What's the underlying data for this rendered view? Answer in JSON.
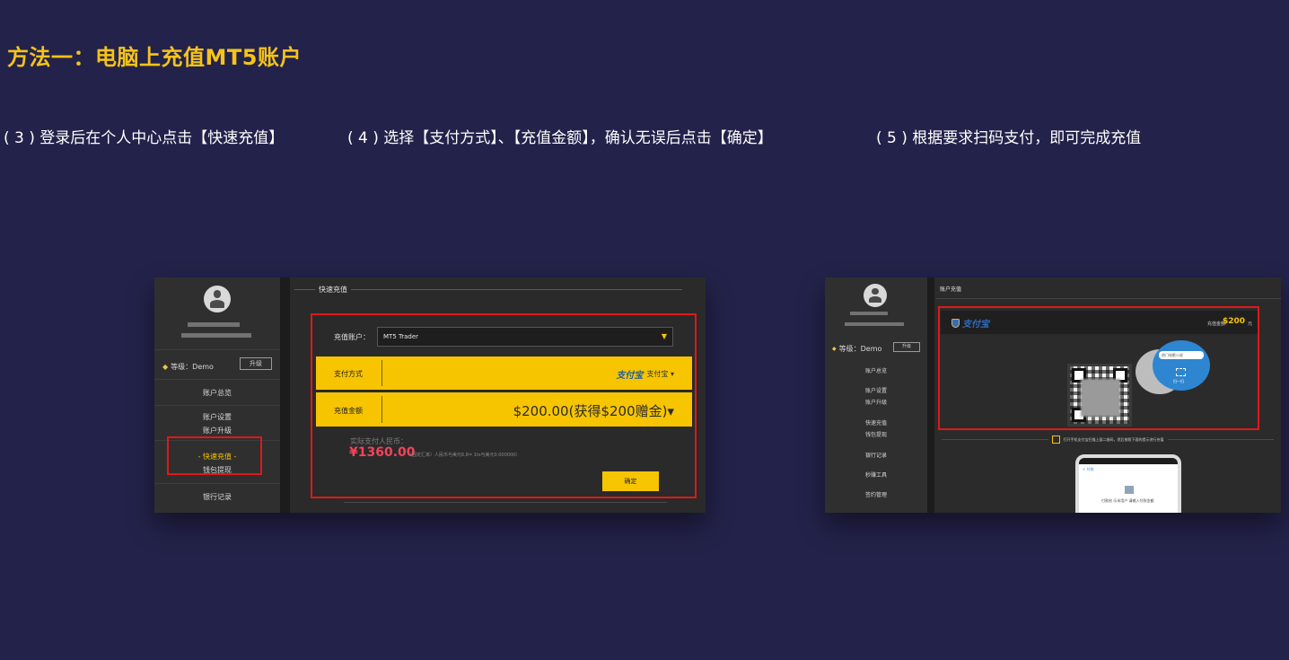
{
  "page": {
    "title": "方法一：电脑上充值MT5账户",
    "steps": [
      "( 3 ) 登录后在个人中心点击【快速充值】",
      "( 4 ) 选择【支付方式】、【充值金额】，确认无误后点击【确定】",
      "( 5 ) 根据要求扫码支付，即可完成充值"
    ]
  },
  "left_screen": {
    "level_label": "等级：Demo",
    "upgrade_button": "升级",
    "menu": [
      "账户总览",
      "账户设置",
      "账户升级",
      "- 快速充值 -",
      "钱包提现",
      "银行记录"
    ],
    "section_title": "快速充值",
    "account_label": "充值账户：",
    "account_value": "MT5 Trader",
    "pay_method_label": "支付方式",
    "pay_method_logo": "支付宝",
    "pay_method_value": "支付宝 ▾",
    "amount_label": "充值金额",
    "amount_value": "$200.00(获得$200赠金)▾",
    "rmb_label": "实际支付人民币：",
    "rmb_value": "¥1360.00",
    "rate_note": "（固定汇率）人民币与美元6.8= 1ts与美元0.000000）",
    "confirm_button": "确定"
  },
  "right_screen": {
    "level_label": "等级：Demo",
    "upgrade_button": "升级",
    "menu": [
      "账户总览",
      "账户设置",
      "账户升级",
      "快速充值",
      "钱包提现",
      "银行记录",
      "秒赚工具",
      "签约管理"
    ],
    "section_title": "账户充值",
    "alipay_logo": "支付宝",
    "charge_label": "充值金额",
    "charge_amount": "$200",
    "charge_unit": "元",
    "bubble_search": "热门电影小说",
    "bubble_scan": "扫一扫",
    "scan_hint": "打开手机支付宝扫描上面二维码，然后按照下面的提示进行充值",
    "phone_back": "< 付款",
    "phone_text": "付款给 乐米用户 请输入付款金额"
  },
  "colors": {
    "background": "#23224a",
    "title": "#f5c31a",
    "accent_yellow": "#f7c400",
    "highlight_red": "#e01818",
    "rmb_red": "#f2445a"
  }
}
